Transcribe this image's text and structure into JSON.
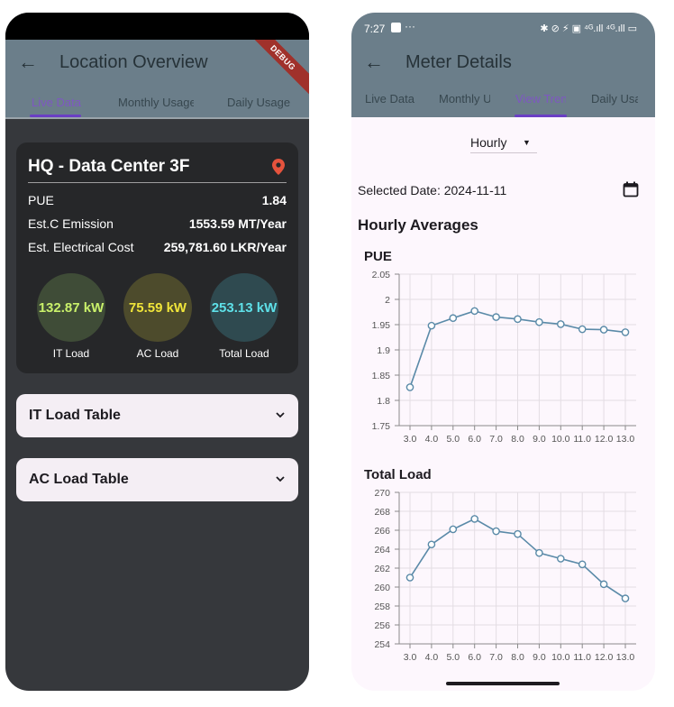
{
  "left": {
    "appbar": {
      "title": "Location Overview",
      "debug_label": "DEBUG"
    },
    "tabs": [
      {
        "label": "Live Data",
        "active": true
      },
      {
        "label": "Monthly Usage",
        "active": false
      },
      {
        "label": "Daily Usage",
        "active": false
      }
    ],
    "card": {
      "title": "HQ - Data Center 3F",
      "icon": "location-pin-icon",
      "rows": [
        {
          "label": "PUE",
          "value": "1.84"
        },
        {
          "label": "Est.C Emission",
          "value": "1553.59 MT/Year"
        },
        {
          "label": "Est. Electrical Cost",
          "value": "259,781.60 LKR/Year"
        }
      ],
      "loads": [
        {
          "value": "132.87 kW",
          "label": "IT Load",
          "color": "#c9f06a",
          "bg": "#3f4c37"
        },
        {
          "value": "75.59 kW",
          "label": "AC Load",
          "color": "#f0e53a",
          "bg": "#4d4b2c"
        },
        {
          "value": "253.13 kW",
          "label": "Total Load",
          "color": "#5ee0e8",
          "bg": "#2f4a50"
        }
      ]
    },
    "expanders": [
      {
        "label": "IT Load Table"
      },
      {
        "label": "AC Load Table"
      }
    ]
  },
  "right": {
    "status": {
      "time": "7:27",
      "dots": "···",
      "indicators": "✱ ⊘ ⚡ ▣ ⁴ᴳ.ıll ⁴ᴳ.ıll ▭"
    },
    "appbar": {
      "title": "Meter Details"
    },
    "tabs": [
      {
        "label": "Live Data",
        "active": false
      },
      {
        "label": "Monthly Usage",
        "active": false
      },
      {
        "label": "View Trends",
        "active": true
      },
      {
        "label": "Daily Usage",
        "active": false
      }
    ],
    "dropdown": {
      "value": "Hourly"
    },
    "selected_date": "Selected Date: 2024-11-11",
    "heading": "Hourly Averages",
    "colors": {
      "line": "#5a8aa8",
      "grid": "#e3dde3",
      "axis": "#8a8a8a"
    }
  },
  "chart_data": [
    {
      "type": "line",
      "title": "PUE",
      "x": [
        3.0,
        4.0,
        5.0,
        6.0,
        7.0,
        8.0,
        9.0,
        10.0,
        11.0,
        12.0,
        13.0
      ],
      "xticks": [
        "3.0",
        "4.0",
        "5.0",
        "6.0",
        "7.0",
        "8.0",
        "9.0",
        "10.0",
        "11.0",
        "12.0",
        "13.0"
      ],
      "values": [
        1.826,
        1.948,
        1.963,
        1.977,
        1.965,
        1.961,
        1.955,
        1.951,
        1.941,
        1.94,
        1.935
      ],
      "yticks": [
        "1.75",
        "1.8",
        "1.85",
        "1.9",
        "1.95",
        "2",
        "2.05"
      ],
      "ylim": [
        1.75,
        2.05
      ],
      "grid": true
    },
    {
      "type": "line",
      "title": "Total Load",
      "x": [
        3.0,
        4.0,
        5.0,
        6.0,
        7.0,
        8.0,
        9.0,
        10.0,
        11.0,
        12.0,
        13.0
      ],
      "xticks": [
        "3.0",
        "4.0",
        "5.0",
        "6.0",
        "7.0",
        "8.0",
        "9.0",
        "10.0",
        "11.0",
        "12.0",
        "13.0"
      ],
      "values": [
        261.0,
        264.5,
        266.1,
        267.2,
        265.9,
        265.6,
        263.6,
        263.0,
        262.4,
        260.3,
        258.8
      ],
      "yticks": [
        "254",
        "256",
        "258",
        "260",
        "262",
        "264",
        "266",
        "268",
        "270"
      ],
      "ylim": [
        254,
        270
      ],
      "grid": true
    }
  ]
}
